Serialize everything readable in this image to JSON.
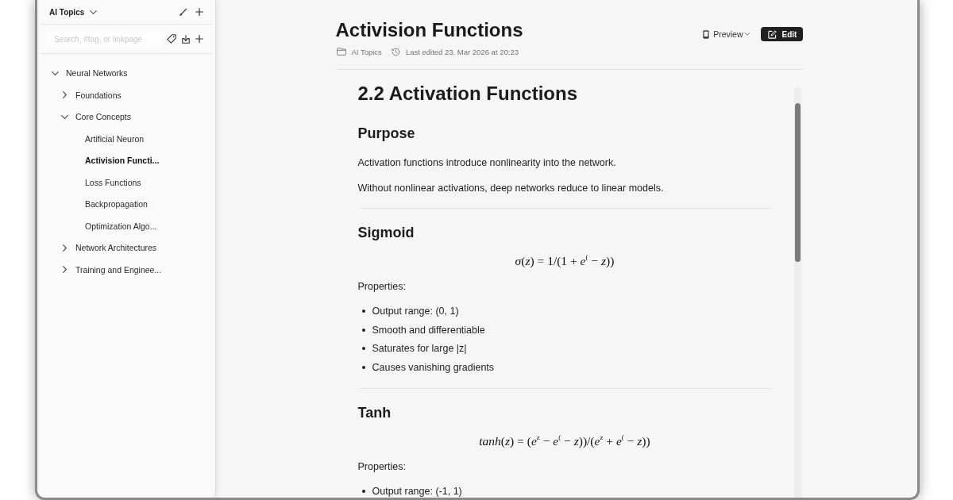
{
  "sidebar": {
    "workspace": "AI Topics",
    "search": {
      "placeholder": "Search, #tag, or linkpage"
    },
    "tree": [
      {
        "label": "Neural Networks",
        "kind": "folder",
        "expanded": true,
        "selected": false,
        "children": [
          {
            "label": "Foundations",
            "kind": "folder",
            "expanded": false,
            "selected": false
          },
          {
            "label": "Core Concepts",
            "kind": "folder",
            "expanded": true,
            "selected": false,
            "children": [
              {
                "label": "Artificial Neuron",
                "kind": "page",
                "selected": false
              },
              {
                "label": "Activision Functi...",
                "kind": "page",
                "selected": true
              },
              {
                "label": "Loss Functions",
                "kind": "page",
                "selected": false
              },
              {
                "label": "Backpropagation",
                "kind": "page",
                "selected": false
              },
              {
                "label": "Optimization Algo...",
                "kind": "page",
                "selected": false
              }
            ]
          },
          {
            "label": "Network Architectures",
            "kind": "folder",
            "expanded": false,
            "selected": false
          },
          {
            "label": "Training and Enginee...",
            "kind": "folder",
            "expanded": false,
            "selected": false
          }
        ]
      }
    ]
  },
  "document": {
    "title": "Activision Functions",
    "folder": "AI Topics",
    "last_edited": "Last edited 23. Mar 2026 at 20:23",
    "view_menu": "Preview",
    "edit_button": "Edit",
    "blocks": [
      {
        "kind": "heading1",
        "text": "2.2 Activation Functions"
      },
      {
        "kind": "heading2",
        "text": "Purpose"
      },
      {
        "kind": "paragraph",
        "text": "Activation functions introduce nonlinearity into the network."
      },
      {
        "kind": "paragraph",
        "text": "Without nonlinear activations, deep networks reduce to linear models."
      },
      {
        "kind": "divider"
      },
      {
        "kind": "heading2",
        "text": "Sigmoid"
      },
      {
        "kind": "formula",
        "text": "*σ*(*z*) = 1/(1 + *e*$^{(}$ − *z*))"
      },
      {
        "kind": "paragraph",
        "text": "Properties:"
      },
      {
        "kind": "list",
        "items": [
          "Output range: (0, 1)",
          "Smooth and differentiable",
          "Saturates for large |z|",
          "Causes vanishing gradients"
        ]
      },
      {
        "kind": "divider"
      },
      {
        "kind": "heading2",
        "text": "Tanh"
      },
      {
        "kind": "formula",
        "text": "*tanh*(*z*) = (*e*$^{z}$ − *e*$^{(}$ − *z*))/(*e*$^{z}$ + *e*$^{(}$ − *z*))"
      },
      {
        "kind": "paragraph",
        "text": "Properties:"
      },
      {
        "kind": "list",
        "items": [
          "Output range: (-1, 1)"
        ]
      }
    ]
  }
}
